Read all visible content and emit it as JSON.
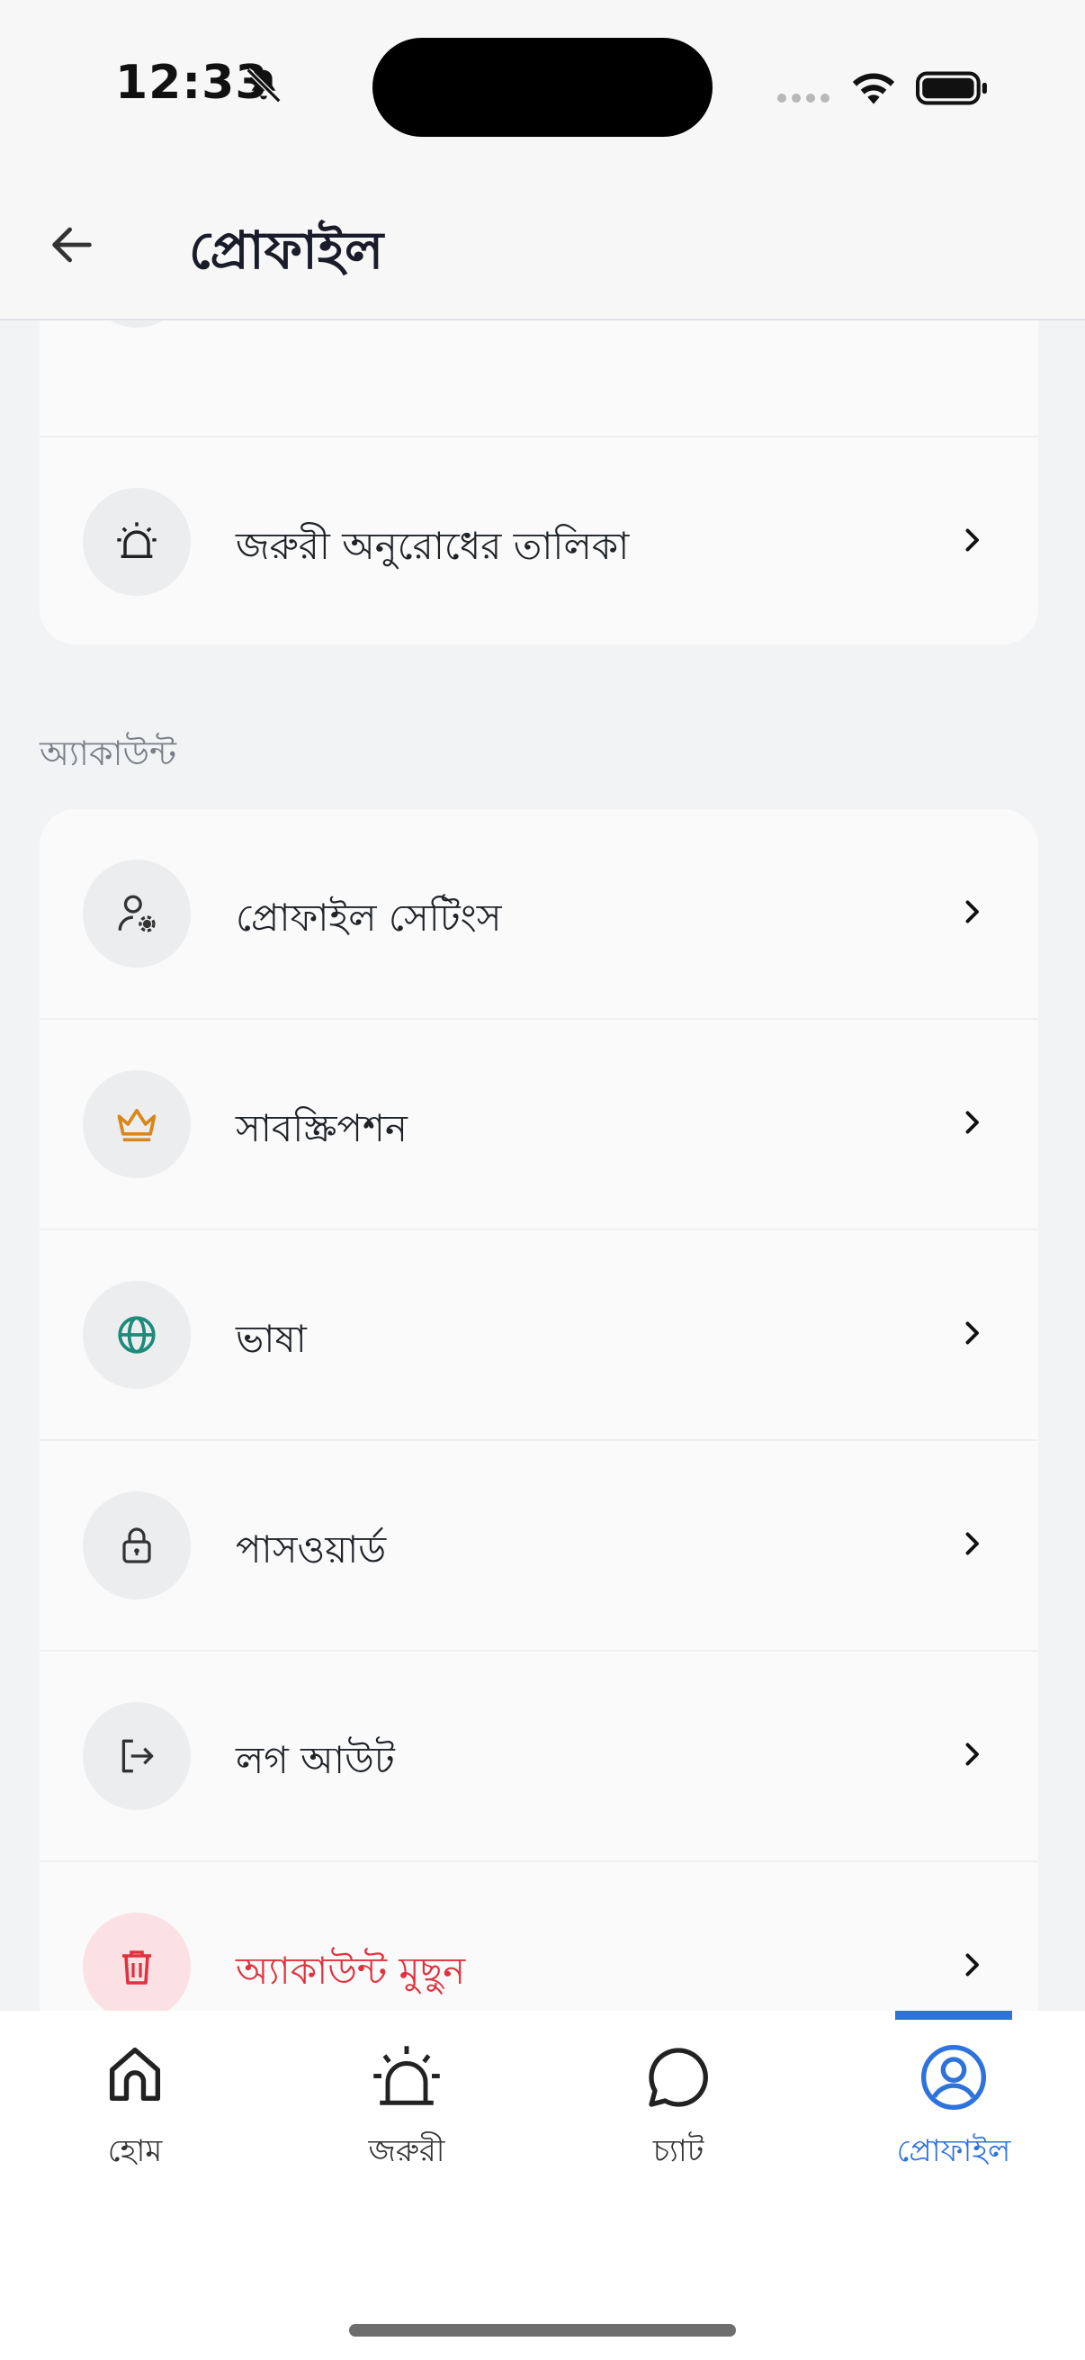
{
  "status_bar": {
    "time": "12:33"
  },
  "header": {
    "title": "প্রোফাইল"
  },
  "sections": {
    "top_items": [
      {
        "label": "জরুরী অনুরোধের তালিকা",
        "icon": "alarm-icon"
      }
    ],
    "account_title": "অ্যাকাউন্ট",
    "account_items": [
      {
        "label": "প্রোফাইল সেটিংস",
        "icon": "user-gear-icon"
      },
      {
        "label": "সাবস্ক্রিপশন",
        "icon": "crown-icon"
      },
      {
        "label": "ভাষা",
        "icon": "globe-icon"
      },
      {
        "label": "পাসওয়ার্ড",
        "icon": "lock-icon"
      },
      {
        "label": "লগ আউট",
        "icon": "logout-icon"
      },
      {
        "label": "অ্যাকাউন্ট মুছুন",
        "icon": "trash-icon"
      }
    ]
  },
  "bottom_nav": {
    "tabs": [
      {
        "label": "হোম",
        "icon": "home-icon"
      },
      {
        "label": "জরুরী",
        "icon": "alarm-icon"
      },
      {
        "label": "চ্যাট",
        "icon": "chat-bubble-icon"
      },
      {
        "label": "প্রোফাইল",
        "icon": "user-circle-icon",
        "active": true
      }
    ]
  },
  "colors": {
    "accent": "#2e72db",
    "danger": "#e0323e",
    "crown": "#d9861a",
    "globe": "#1e8a7a"
  }
}
